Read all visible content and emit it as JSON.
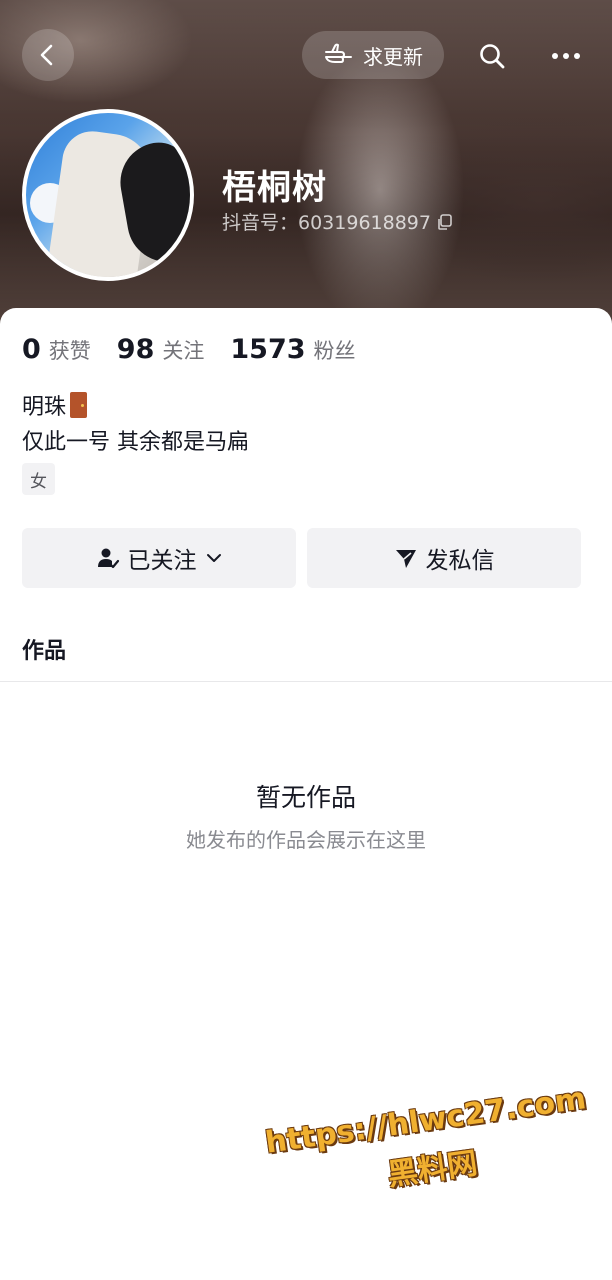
{
  "header": {
    "update_label": "求更新",
    "icons": [
      "back-icon",
      "hand-point-icon",
      "search-icon",
      "more-icon"
    ]
  },
  "profile": {
    "name": "梧桐树",
    "douyin_id": "抖音号：60319618897",
    "copy_icon": "copy-icon"
  },
  "stats": [
    {
      "value": "0",
      "label": "获赞"
    },
    {
      "value": "98",
      "label": "关注"
    },
    {
      "value": "1573",
      "label": "粉丝"
    }
  ],
  "bio": {
    "line1": "明珠",
    "line1_icon": "door-emoji",
    "line2": "仅此一号 其余都是马扁"
  },
  "tag": "女",
  "actions": {
    "followed_label": "已关注",
    "message_label": "发私信"
  },
  "tabs": {
    "works_label": "作品"
  },
  "empty_state": {
    "title": "暂无作品",
    "subtitle": "她发布的作品会展示在这里"
  },
  "watermark": {
    "url": "https://hlwc27.com",
    "name": "黑料网"
  },
  "colors": {
    "accent_text": "#161823",
    "muted_text": "#737379",
    "button_bg": "#f2f2f4",
    "watermark": "#f0b030"
  }
}
